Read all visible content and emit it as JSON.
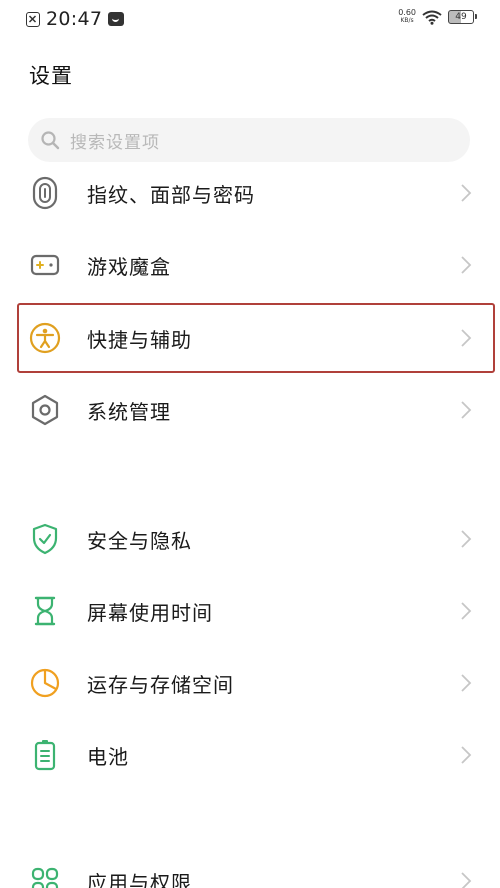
{
  "status_bar": {
    "time": "20:47",
    "net_speed_value": "0.60",
    "net_speed_unit": "KB/s",
    "battery": "49"
  },
  "page": {
    "title": "设置"
  },
  "search": {
    "placeholder": "搜索设置项"
  },
  "settings": {
    "items": [
      {
        "label": "指纹、面部与密码",
        "icon": "fingerprint-icon",
        "color": "#6b6b6b"
      },
      {
        "label": "游戏魔盒",
        "icon": "gamepad-icon",
        "color": "#6b6b6b"
      },
      {
        "label": "快捷与辅助",
        "icon": "accessibility-icon",
        "color": "#e0a020"
      },
      {
        "label": "系统管理",
        "icon": "hexagon-gear-icon",
        "color": "#6b6b6b"
      },
      {
        "label": "安全与隐私",
        "icon": "shield-check-icon",
        "color": "#3cb371"
      },
      {
        "label": "屏幕使用时间",
        "icon": "hourglass-icon",
        "color": "#3cb371"
      },
      {
        "label": "运存与存储空间",
        "icon": "pie-chart-icon",
        "color": "#f0a020"
      },
      {
        "label": "电池",
        "icon": "battery-icon",
        "color": "#3cb371"
      },
      {
        "label": "应用与权限",
        "icon": "apps-grid-icon",
        "color": "#3cb371"
      }
    ]
  },
  "highlight": {
    "color": "#b0403a"
  }
}
